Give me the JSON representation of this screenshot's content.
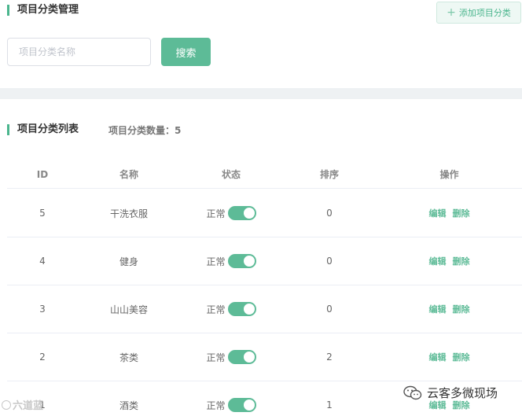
{
  "header": {
    "title": "项目分类管理",
    "add_button_label": "添加项目分类"
  },
  "search": {
    "placeholder": "项目分类名称",
    "value": "",
    "button_label": "搜索"
  },
  "list": {
    "title": "项目分类列表",
    "count_label": "项目分类数量：",
    "count": "5",
    "columns": [
      "ID",
      "名称",
      "状态",
      "排序",
      "操作"
    ],
    "rows": [
      {
        "id": "5",
        "name": "干洗衣服",
        "status": "正常",
        "sort": "0"
      },
      {
        "id": "4",
        "name": "健身",
        "status": "正常",
        "sort": "0"
      },
      {
        "id": "3",
        "name": "山山美容",
        "status": "正常",
        "sort": "0"
      },
      {
        "id": "2",
        "name": "茶类",
        "status": "正常",
        "sort": "2"
      },
      {
        "id": "1",
        "name": "酒类",
        "status": "正常",
        "sort": "1"
      }
    ],
    "edit_label": "编辑",
    "delete_label": "删除"
  },
  "watermarks": {
    "left": "六道蓝",
    "right": "云客多微现场"
  },
  "colors": {
    "accent": "#5dbb97",
    "background": "#eef1f3"
  }
}
